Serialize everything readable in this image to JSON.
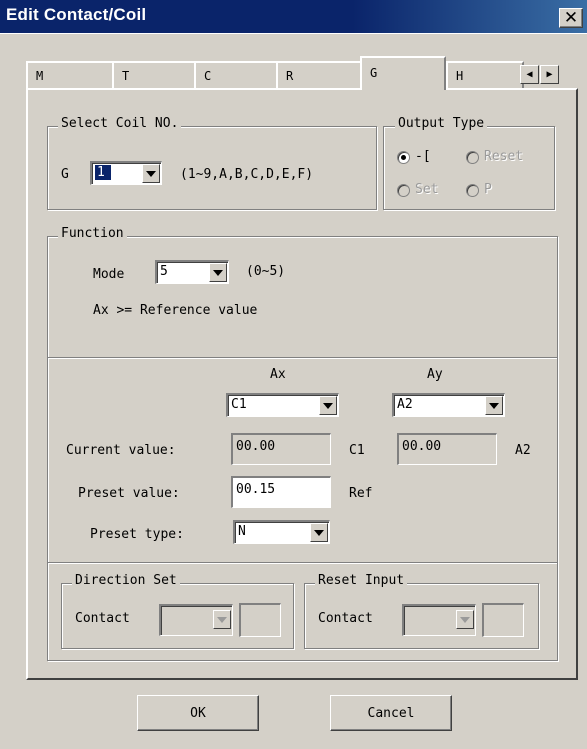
{
  "window": {
    "title": "Edit Contact/Coil",
    "close_icon": "close-icon"
  },
  "tabs": [
    {
      "label": "M",
      "active": false
    },
    {
      "label": "T",
      "active": false
    },
    {
      "label": "C",
      "active": false
    },
    {
      "label": "R",
      "active": false
    },
    {
      "label": "G",
      "active": true
    },
    {
      "label": "H",
      "active": false
    }
  ],
  "tab_scroll": {
    "left": "◀",
    "right": "▶"
  },
  "select_coil": {
    "legend": "Select Coil NO.",
    "prefix": "G",
    "value": "1",
    "range_hint": "(1~9,A,B,C,D,E,F)"
  },
  "output_type": {
    "legend": "Output Type",
    "options": [
      {
        "label": "-[",
        "checked": true,
        "enabled": true
      },
      {
        "label": "Reset",
        "checked": false,
        "enabled": false
      },
      {
        "label": "Set",
        "checked": false,
        "enabled": false
      },
      {
        "label": "P",
        "checked": false,
        "enabled": false
      }
    ]
  },
  "function": {
    "legend": "Function",
    "mode_label": "Mode",
    "mode_value": "5",
    "mode_range": "(0~5)",
    "description": "Ax >= Reference value"
  },
  "analog": {
    "ax_header": "Ax",
    "ay_header": "Ay",
    "ax_value": "C1",
    "ay_value": "A2",
    "current_label": "Current value:",
    "current_ax": "00.00",
    "current_ax_unit": "C1",
    "current_ay": "00.00",
    "current_ay_unit": "A2",
    "preset_label": "Preset value:",
    "preset_value": "00.15",
    "preset_unit": "Ref",
    "preset_type_label": "Preset type:",
    "preset_type_value": "N"
  },
  "direction_set": {
    "legend": "Direction Set",
    "contact_label": "Contact"
  },
  "reset_input": {
    "legend": "Reset Input",
    "contact_label": "Contact"
  },
  "buttons": {
    "ok": "OK",
    "cancel": "Cancel"
  }
}
